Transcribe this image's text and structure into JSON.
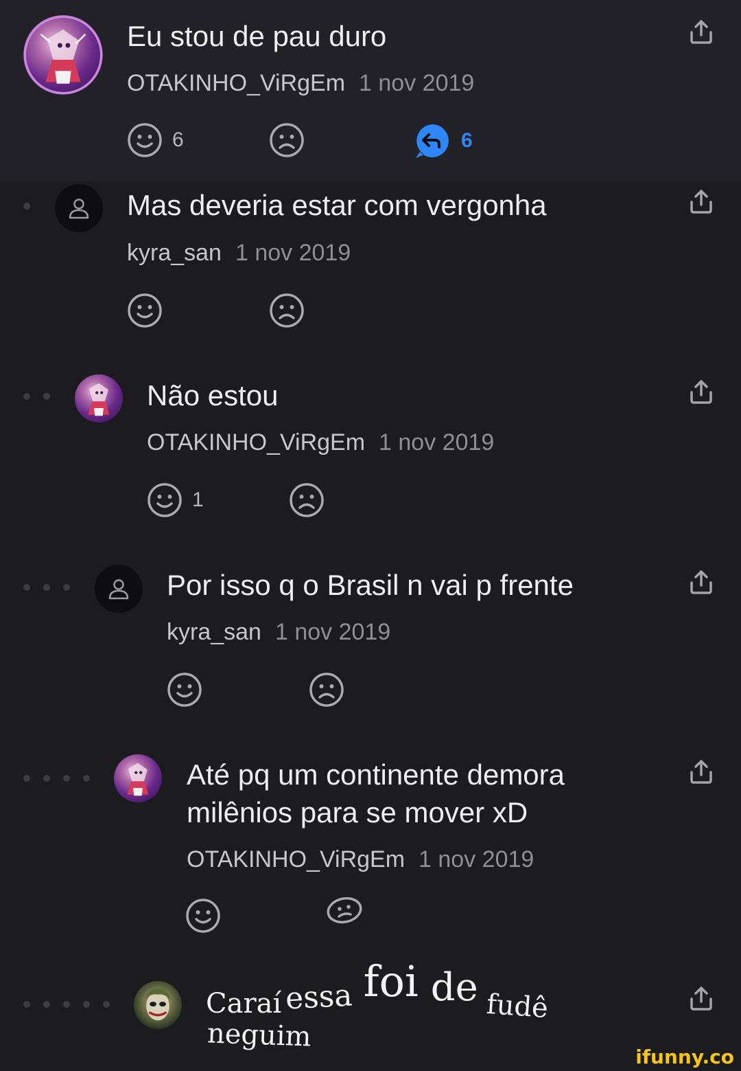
{
  "comments": [
    {
      "text": "Eu stou de pau duro",
      "author": "OTAKINHO_ViRgEm",
      "date": "1 nov 2019",
      "likes": "6",
      "replies": "6",
      "avatar": "anime-avatar"
    },
    {
      "text": "Mas deveria estar com vergonha",
      "author": "kyra_san",
      "date": "1 nov 2019",
      "avatar": "default-user-avatar"
    },
    {
      "text": "Não estou",
      "author": "OTAKINHO_ViRgEm",
      "date": "1 nov 2019",
      "likes": "1",
      "avatar": "anime-avatar"
    },
    {
      "text": "Por isso q o Brasil n vai p frente",
      "author": "kyra_san",
      "date": "1 nov 2019",
      "avatar": "default-user-avatar"
    },
    {
      "text_line1": "Até pq um continente demora",
      "text_line2": "milênios para se mover xD",
      "author": "OTAKINHO_ViRgEm",
      "date": "1 nov 2019",
      "avatar": "anime-avatar"
    },
    {
      "words": [
        "Caraí",
        "essa",
        "foi",
        "de",
        "fudê"
      ],
      "line2": "neguim",
      "avatar": "joker-avatar"
    }
  ],
  "icons": {
    "like": "smile-icon",
    "dislike": "frown-icon",
    "reply": "reply-icon",
    "share": "share-icon",
    "thread_dot": "thread-depth-dot"
  },
  "colors": {
    "background": "#1b1b20",
    "highlight_background": "#212127",
    "accent": "#2f86f6",
    "watermark": "#f5c518"
  },
  "watermark": "ifunny.co"
}
